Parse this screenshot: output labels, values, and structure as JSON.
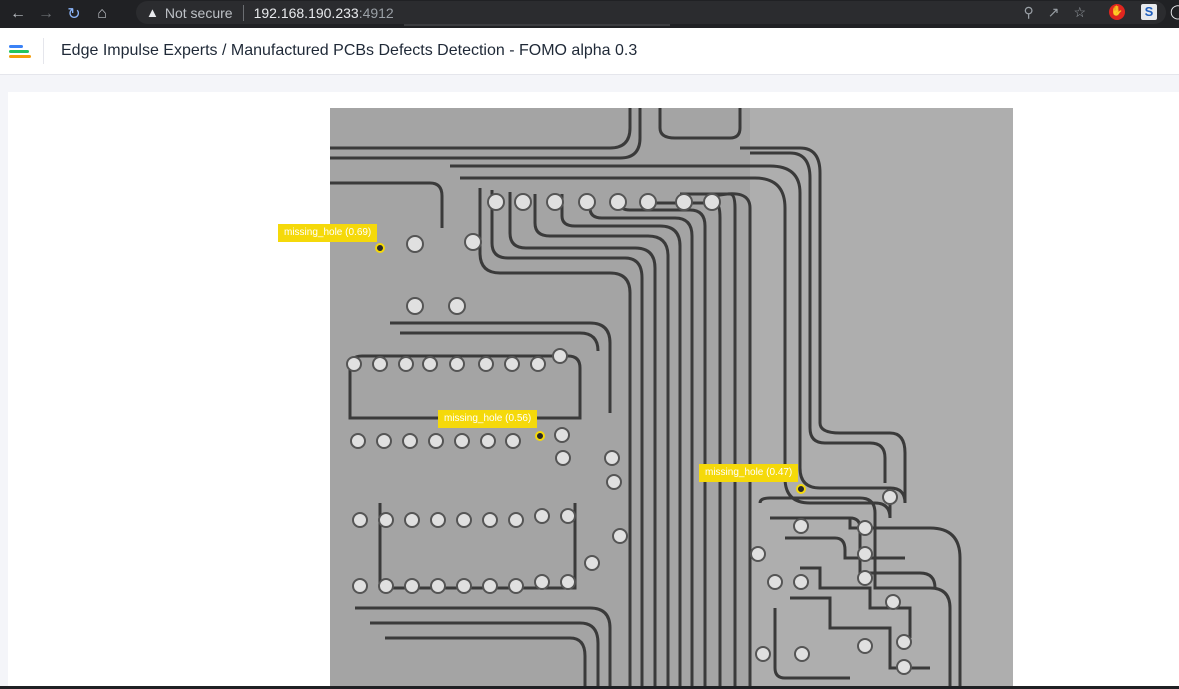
{
  "browser": {
    "security_label": "Not secure",
    "url_host": "192.168.190.233",
    "url_port": ":4912",
    "icons": [
      "back-arrow-icon",
      "forward-arrow-icon",
      "reload-icon",
      "home-icon",
      "warning-icon",
      "zoom-icon",
      "share-icon",
      "star-icon"
    ]
  },
  "header": {
    "title": "Edge Impulse Experts / Manufactured PCBs Defects Detection - FOMO alpha 0.3"
  },
  "colors": {
    "accent_yellow": "#f5d90a",
    "logo": [
      "#3b82f6",
      "#22c55e",
      "#f59e0b",
      "#ef4444"
    ]
  },
  "detections": [
    {
      "label": "missing_hole (0.69)"
    },
    {
      "label": "missing_hole (0.56)"
    },
    {
      "label": "missing_hole (0.47)"
    }
  ]
}
